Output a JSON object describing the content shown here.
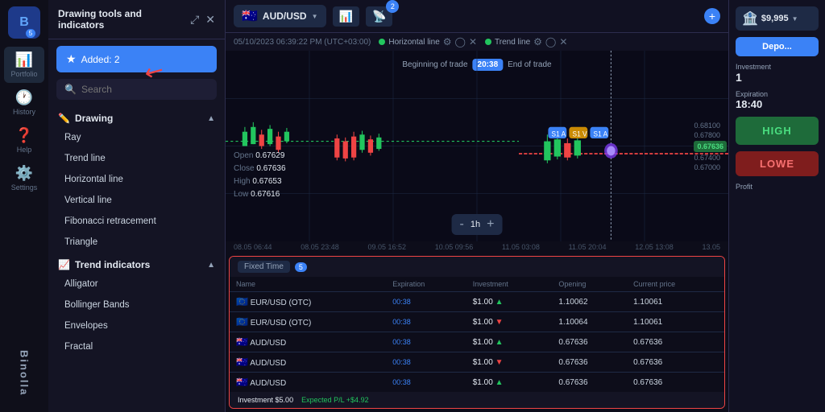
{
  "app": {
    "name": "Binolla",
    "logo": "B"
  },
  "sidebar": {
    "items": [
      {
        "label": "Portfolio",
        "icon": "📊",
        "badge": "5",
        "active": true
      },
      {
        "label": "History",
        "icon": "🕐",
        "active": false
      },
      {
        "label": "Help",
        "icon": "❓",
        "active": false
      },
      {
        "label": "Settings",
        "icon": "⚙️",
        "active": false
      }
    ]
  },
  "drawing_panel": {
    "title": "Drawing tools and indicators",
    "added_label": "Added: 2",
    "search_placeholder": "Search",
    "sections": [
      {
        "name": "Drawing",
        "tools": [
          "Ray",
          "Trend line",
          "Horizontal line",
          "Vertical line",
          "Fibonacci retracement",
          "Triangle"
        ]
      },
      {
        "name": "Trend indicators",
        "tools": [
          "Alligator",
          "Bollinger Bands",
          "Envelopes",
          "Fractal"
        ]
      }
    ]
  },
  "chart_header": {
    "pair": "AUD/USD",
    "timestamp": "05/10/2023  06:39:22 PM (UTC+03:00)",
    "indicators": [
      {
        "name": "Horizontal line",
        "color": "green"
      },
      {
        "name": "Trend line",
        "color": "green"
      }
    ]
  },
  "trade_info": {
    "beginning": "Beginning of trade",
    "end": "End of trade",
    "time_badge": "20:38"
  },
  "ohlc": {
    "open_label": "Open",
    "open_value": "0.67629",
    "close_label": "Close",
    "close_value": "0.67636",
    "high_label": "High",
    "high_value": "0.67653",
    "low_label": "Low",
    "low_value": "0.67616"
  },
  "zoom": {
    "minus": "-",
    "level": "1h",
    "plus": "+"
  },
  "timeline": {
    "labels": [
      "08.05 06:44",
      "08.05 23:48",
      "09.05 16:52",
      "10.05 09:56",
      "11.05 03:08",
      "11.05 20:04",
      "12.05 13:08",
      "13.05"
    ]
  },
  "right_panel": {
    "balance_icon": "🏦",
    "balance": "$9,995",
    "deposit_label": "Depo...",
    "investment_label": "Investment",
    "investment_value": "1",
    "expiration_label": "Expiration",
    "expiration_value": "18:40",
    "high_label": "HIGH",
    "low_label": "LOWE",
    "profit_label": "Profit",
    "price_value": "0.67636"
  },
  "positions": {
    "tab_label": "Fixed Time",
    "count": "5",
    "columns": [
      "Name",
      "Expiration",
      "Investment",
      "Opening",
      "Current price"
    ],
    "rows": [
      {
        "name": "EUR/USD (OTC)",
        "flag": "EU",
        "expiration": "00:38",
        "investment": "$1.00",
        "direction": "up",
        "opening": "1.10062",
        "current": "1.10061"
      },
      {
        "name": "EUR/USD (OTC)",
        "flag": "EU",
        "expiration": "00:38",
        "investment": "$1.00",
        "direction": "down",
        "opening": "1.10064",
        "current": "1.10061"
      },
      {
        "name": "AUD/USD",
        "flag": "AU",
        "expiration": "00:38",
        "investment": "$1.00",
        "direction": "up",
        "opening": "0.67636",
        "current": "0.67636"
      },
      {
        "name": "AUD/USD",
        "flag": "AU",
        "expiration": "00:38",
        "investment": "$1.00",
        "direction": "down",
        "opening": "0.67636",
        "current": "0.67636"
      },
      {
        "name": "AUD/USD",
        "flag": "AU",
        "expiration": "00:38",
        "investment": "$1.00",
        "direction": "up",
        "opening": "0.67636",
        "current": "0.67636"
      }
    ],
    "footer": {
      "investment_label": "Investment",
      "investment_value": "$5.00",
      "pnl_label": "Expected P/L",
      "pnl_value": "+$4.92"
    }
  }
}
